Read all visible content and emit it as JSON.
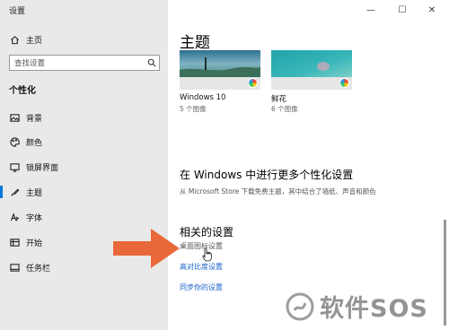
{
  "window": {
    "title": "设置",
    "controls": {
      "minimize": "—",
      "maximize": "☐",
      "close": "✕"
    }
  },
  "nav": {
    "home_label": "主页",
    "search_placeholder": "查找设置",
    "section_heading": "个性化",
    "items": [
      {
        "label": "背景",
        "icon": "image-icon"
      },
      {
        "label": "颜色",
        "icon": "palette-icon"
      },
      {
        "label": "锁屏界面",
        "icon": "lock-screen-icon"
      },
      {
        "label": "主题",
        "icon": "brush-icon",
        "active": true
      },
      {
        "label": "字体",
        "icon": "font-icon"
      },
      {
        "label": "开始",
        "icon": "start-icon"
      },
      {
        "label": "任务栏",
        "icon": "taskbar-icon"
      }
    ]
  },
  "main": {
    "title": "主题",
    "themes": [
      {
        "name": "Windows 10",
        "count": "5 个图像"
      },
      {
        "name": "鲜花",
        "count": "6 个图像"
      }
    ],
    "more": {
      "heading": "在 Windows 中进行更多个性化设置",
      "description": "从 Microsoft Store 下载免费主题，其中结合了墙纸、声音和颜色"
    },
    "related": {
      "heading": "相关的设置",
      "links": [
        "桌面图标设置",
        "高对比度设置",
        "同步你的设置"
      ]
    }
  },
  "watermark": {
    "text": "软件SOS"
  },
  "colors": {
    "accent": "#0078d7",
    "link": "#1a62c8",
    "nav_bg": "#e9e9e9",
    "arrow": "#e8683a"
  }
}
